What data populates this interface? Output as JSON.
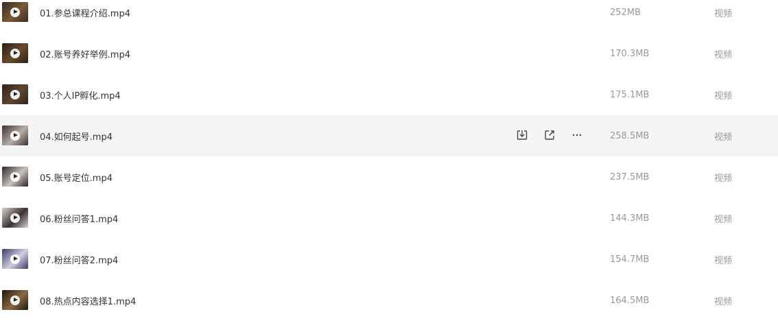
{
  "files": [
    {
      "name": "01.参总课程介绍.mp4",
      "size": "252MB",
      "type": "视频",
      "thumb_colors": [
        "#3a2a1e",
        "#7a5a3a"
      ]
    },
    {
      "name": "02.账号养好举例.mp4",
      "size": "170.3MB",
      "type": "视频",
      "thumb_colors": [
        "#2a2018",
        "#6a4a2a"
      ]
    },
    {
      "name": "03.个人IP孵化.mp4",
      "size": "175.1MB",
      "type": "视频",
      "thumb_colors": [
        "#2e241c",
        "#5e4630"
      ]
    },
    {
      "name": "04.如何起号.mp4",
      "size": "258.5MB",
      "type": "视频",
      "thumb_colors": [
        "#3b3030",
        "#b8b0a8"
      ]
    },
    {
      "name": "05.账号定位.mp4",
      "size": "237.5MB",
      "type": "视频",
      "thumb_colors": [
        "#2b2626",
        "#c9c4be"
      ]
    },
    {
      "name": "06.粉丝问答1.mp4",
      "size": "144.3MB",
      "type": "视频",
      "thumb_colors": [
        "#d8d4d0",
        "#3a3030"
      ]
    },
    {
      "name": "07.粉丝问答2.mp4",
      "size": "154.7MB",
      "type": "视频",
      "thumb_colors": [
        "#3a3a6a",
        "#d0d0e0"
      ]
    },
    {
      "name": "08.热点内容选择1.mp4",
      "size": "164.5MB",
      "type": "视频",
      "thumb_colors": [
        "#1c1612",
        "#8a6a40"
      ]
    }
  ],
  "hovered_index": 3,
  "actions": [
    {
      "icon": "download-icon"
    },
    {
      "icon": "share-icon"
    },
    {
      "icon": "more-icon"
    }
  ]
}
